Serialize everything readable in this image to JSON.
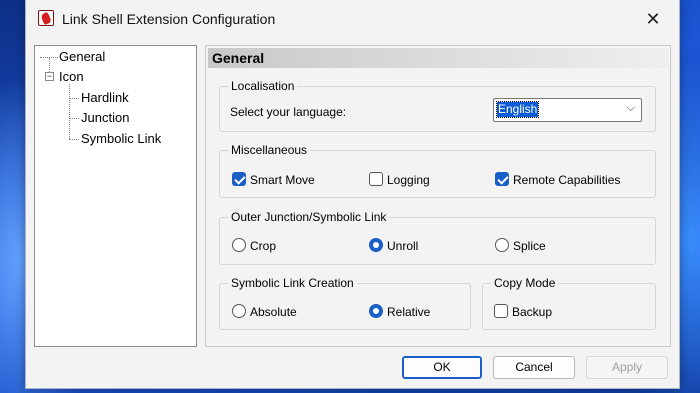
{
  "window": {
    "title": "Link Shell Extension Configuration",
    "close_glyph": "✕"
  },
  "tree": {
    "items": [
      {
        "label": "General",
        "selected": true
      },
      {
        "label": "Icon",
        "expander": "−"
      },
      {
        "label": "Hardlink"
      },
      {
        "label": "Junction"
      },
      {
        "label": "Symbolic Link"
      }
    ]
  },
  "panel": {
    "header": "General",
    "localisation": {
      "group_label": "Localisation",
      "prompt": "Select your language:",
      "language_value": "English",
      "chevron": "⌵"
    },
    "misc": {
      "group_label": "Miscellaneous",
      "smart_move": {
        "label": "Smart Move",
        "checked": true
      },
      "logging": {
        "label": "Logging",
        "checked": false
      },
      "remote": {
        "label": "Remote Capabilities",
        "checked": true
      }
    },
    "outer": {
      "group_label": "Outer Junction/Symbolic Link",
      "crop": {
        "label": "Crop",
        "selected": false
      },
      "unroll": {
        "label": "Unroll",
        "selected": true
      },
      "splice": {
        "label": "Splice",
        "selected": false
      }
    },
    "symlink": {
      "group_label": "Symbolic Link Creation",
      "absolute": {
        "label": "Absolute",
        "selected": false
      },
      "relative": {
        "label": "Relative",
        "selected": true
      }
    },
    "copy_mode": {
      "group_label": "Copy Mode",
      "backup": {
        "label": "Backup",
        "checked": false
      }
    }
  },
  "buttons": {
    "ok": "OK",
    "cancel": "Cancel",
    "apply": "Apply"
  },
  "colors": {
    "accent": "#1a5fc8",
    "selection": "#0a5bd4",
    "window_bg": "#f3f3f3"
  }
}
